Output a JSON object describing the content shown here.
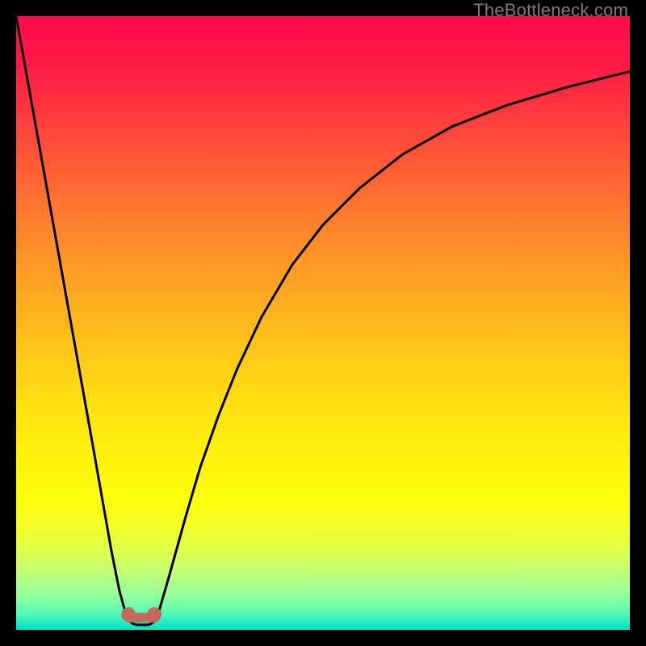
{
  "watermark": {
    "text": "TheBottleneck.com"
  },
  "chart_data": {
    "type": "line",
    "title": "",
    "xlabel": "",
    "ylabel": "",
    "xlim": [
      0,
      100
    ],
    "ylim": [
      0,
      100
    ],
    "grid": false,
    "legend": false,
    "series": [
      {
        "name": "left-branch",
        "x": [
          0.0,
          2.5,
          5.0,
          7.5,
          10.0,
          12.5,
          14.0,
          15.5,
          16.8,
          17.8
        ],
        "y": [
          100.0,
          86.0,
          72.0,
          58.0,
          44.0,
          30.0,
          21.5,
          13.0,
          6.5,
          2.8
        ],
        "color": "#000000"
      },
      {
        "name": "valley-floor",
        "x": [
          17.8,
          18.4,
          19.0,
          19.8,
          20.6,
          21.4,
          22.0,
          22.6,
          23.2
        ],
        "y": [
          2.8,
          1.5,
          1.0,
          0.8,
          0.8,
          0.8,
          1.0,
          1.5,
          2.8
        ],
        "color": "#000000"
      },
      {
        "name": "knob-left",
        "x": [
          17.6,
          17.9,
          18.4,
          18.9,
          19.2,
          18.9,
          18.4,
          17.9,
          17.6
        ],
        "y": [
          2.5,
          3.3,
          3.6,
          3.3,
          2.5,
          1.7,
          1.4,
          1.7,
          2.5
        ],
        "color": "#c26a60"
      },
      {
        "name": "knob-right",
        "x": [
          21.8,
          22.1,
          22.6,
          23.1,
          23.4,
          23.1,
          22.6,
          22.1,
          21.8
        ],
        "y": [
          2.5,
          3.3,
          3.6,
          3.3,
          2.5,
          1.7,
          1.4,
          1.7,
          2.5
        ],
        "color": "#c26a60"
      },
      {
        "name": "knob-bar",
        "x": [
          18.4,
          22.6
        ],
        "y": [
          2.0,
          2.0
        ],
        "color": "#c26a60"
      },
      {
        "name": "right-branch",
        "x": [
          23.2,
          25.0,
          27.5,
          30.0,
          33.0,
          36.0,
          40.0,
          45.0,
          50.0,
          56.0,
          63.0,
          71.0,
          80.0,
          90.0,
          100.0
        ],
        "y": [
          2.8,
          9.0,
          18.0,
          26.5,
          35.0,
          42.5,
          51.0,
          59.5,
          66.0,
          72.0,
          77.5,
          82.0,
          85.5,
          88.5,
          91.0
        ],
        "color": "#000000"
      }
    ]
  }
}
